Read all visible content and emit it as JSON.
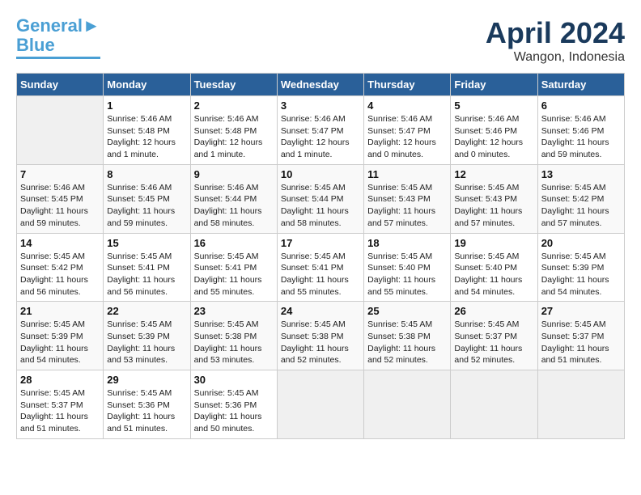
{
  "header": {
    "logo_line1": "General",
    "logo_line2": "Blue",
    "month": "April 2024",
    "location": "Wangon, Indonesia"
  },
  "columns": [
    "Sunday",
    "Monday",
    "Tuesday",
    "Wednesday",
    "Thursday",
    "Friday",
    "Saturday"
  ],
  "weeks": [
    [
      {
        "day": "",
        "info": ""
      },
      {
        "day": "1",
        "info": "Sunrise: 5:46 AM\nSunset: 5:48 PM\nDaylight: 12 hours\nand 1 minute."
      },
      {
        "day": "2",
        "info": "Sunrise: 5:46 AM\nSunset: 5:48 PM\nDaylight: 12 hours\nand 1 minute."
      },
      {
        "day": "3",
        "info": "Sunrise: 5:46 AM\nSunset: 5:47 PM\nDaylight: 12 hours\nand 1 minute."
      },
      {
        "day": "4",
        "info": "Sunrise: 5:46 AM\nSunset: 5:47 PM\nDaylight: 12 hours\nand 0 minutes."
      },
      {
        "day": "5",
        "info": "Sunrise: 5:46 AM\nSunset: 5:46 PM\nDaylight: 12 hours\nand 0 minutes."
      },
      {
        "day": "6",
        "info": "Sunrise: 5:46 AM\nSunset: 5:46 PM\nDaylight: 11 hours\nand 59 minutes."
      }
    ],
    [
      {
        "day": "7",
        "info": "Sunrise: 5:46 AM\nSunset: 5:45 PM\nDaylight: 11 hours\nand 59 minutes."
      },
      {
        "day": "8",
        "info": "Sunrise: 5:46 AM\nSunset: 5:45 PM\nDaylight: 11 hours\nand 59 minutes."
      },
      {
        "day": "9",
        "info": "Sunrise: 5:46 AM\nSunset: 5:44 PM\nDaylight: 11 hours\nand 58 minutes."
      },
      {
        "day": "10",
        "info": "Sunrise: 5:45 AM\nSunset: 5:44 PM\nDaylight: 11 hours\nand 58 minutes."
      },
      {
        "day": "11",
        "info": "Sunrise: 5:45 AM\nSunset: 5:43 PM\nDaylight: 11 hours\nand 57 minutes."
      },
      {
        "day": "12",
        "info": "Sunrise: 5:45 AM\nSunset: 5:43 PM\nDaylight: 11 hours\nand 57 minutes."
      },
      {
        "day": "13",
        "info": "Sunrise: 5:45 AM\nSunset: 5:42 PM\nDaylight: 11 hours\nand 57 minutes."
      }
    ],
    [
      {
        "day": "14",
        "info": "Sunrise: 5:45 AM\nSunset: 5:42 PM\nDaylight: 11 hours\nand 56 minutes."
      },
      {
        "day": "15",
        "info": "Sunrise: 5:45 AM\nSunset: 5:41 PM\nDaylight: 11 hours\nand 56 minutes."
      },
      {
        "day": "16",
        "info": "Sunrise: 5:45 AM\nSunset: 5:41 PM\nDaylight: 11 hours\nand 55 minutes."
      },
      {
        "day": "17",
        "info": "Sunrise: 5:45 AM\nSunset: 5:41 PM\nDaylight: 11 hours\nand 55 minutes."
      },
      {
        "day": "18",
        "info": "Sunrise: 5:45 AM\nSunset: 5:40 PM\nDaylight: 11 hours\nand 55 minutes."
      },
      {
        "day": "19",
        "info": "Sunrise: 5:45 AM\nSunset: 5:40 PM\nDaylight: 11 hours\nand 54 minutes."
      },
      {
        "day": "20",
        "info": "Sunrise: 5:45 AM\nSunset: 5:39 PM\nDaylight: 11 hours\nand 54 minutes."
      }
    ],
    [
      {
        "day": "21",
        "info": "Sunrise: 5:45 AM\nSunset: 5:39 PM\nDaylight: 11 hours\nand 54 minutes."
      },
      {
        "day": "22",
        "info": "Sunrise: 5:45 AM\nSunset: 5:39 PM\nDaylight: 11 hours\nand 53 minutes."
      },
      {
        "day": "23",
        "info": "Sunrise: 5:45 AM\nSunset: 5:38 PM\nDaylight: 11 hours\nand 53 minutes."
      },
      {
        "day": "24",
        "info": "Sunrise: 5:45 AM\nSunset: 5:38 PM\nDaylight: 11 hours\nand 52 minutes."
      },
      {
        "day": "25",
        "info": "Sunrise: 5:45 AM\nSunset: 5:38 PM\nDaylight: 11 hours\nand 52 minutes."
      },
      {
        "day": "26",
        "info": "Sunrise: 5:45 AM\nSunset: 5:37 PM\nDaylight: 11 hours\nand 52 minutes."
      },
      {
        "day": "27",
        "info": "Sunrise: 5:45 AM\nSunset: 5:37 PM\nDaylight: 11 hours\nand 51 minutes."
      }
    ],
    [
      {
        "day": "28",
        "info": "Sunrise: 5:45 AM\nSunset: 5:37 PM\nDaylight: 11 hours\nand 51 minutes."
      },
      {
        "day": "29",
        "info": "Sunrise: 5:45 AM\nSunset: 5:36 PM\nDaylight: 11 hours\nand 51 minutes."
      },
      {
        "day": "30",
        "info": "Sunrise: 5:45 AM\nSunset: 5:36 PM\nDaylight: 11 hours\nand 50 minutes."
      },
      {
        "day": "",
        "info": ""
      },
      {
        "day": "",
        "info": ""
      },
      {
        "day": "",
        "info": ""
      },
      {
        "day": "",
        "info": ""
      }
    ]
  ]
}
